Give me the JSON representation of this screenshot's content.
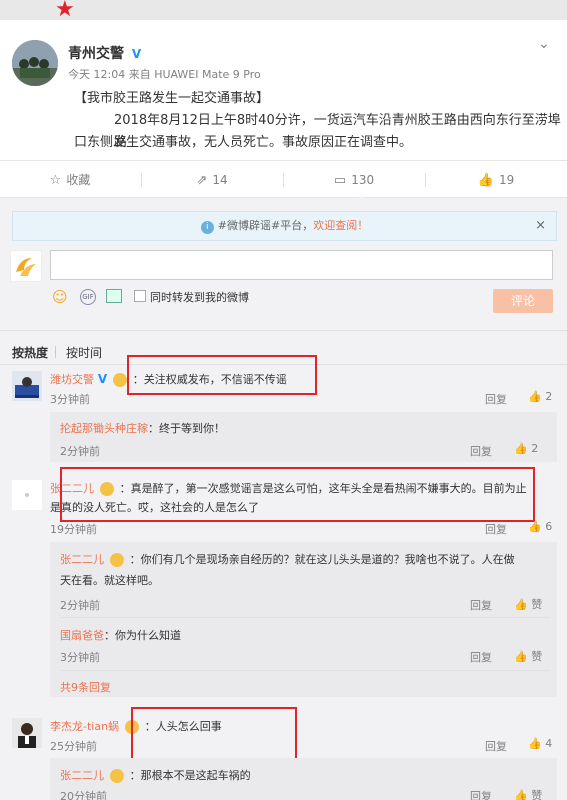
{
  "post": {
    "author": "青州交警",
    "meta": "今天 12:04 来自 HUAWEI Mate 9 Pro",
    "title": "【我市胶王路发生一起交通事故】",
    "body_line1": "2018年8月12日上午8时40分许，一货运汽车沿青州胶王路由西向东行至涝埠路",
    "body_line2": "口东侧发生交通事故，无人员死亡。事故原因正在调查中。"
  },
  "actions": {
    "favorite": "收藏",
    "forward": "14",
    "comment": "130",
    "like": "19"
  },
  "notice": {
    "prefix": "#微博辟谣#平台，",
    "highlight": "欢迎查阅！"
  },
  "composer": {
    "sync_label": "同时转发到我的微博",
    "submit": "评论"
  },
  "sort": {
    "hot": "按热度",
    "time": "按时间"
  },
  "comments": [
    {
      "name": "潍坊交警",
      "text": "：关注权威发布，不信谣不传谣",
      "time": "3分钟前",
      "reply": "回复",
      "likes": "2",
      "replies": [
        {
          "name": "抡起那锄头种庄稼",
          "text": "：终于等到你！",
          "time": "2分钟前",
          "reply": "回复",
          "likes": "2"
        }
      ]
    },
    {
      "name": "张二二儿",
      "text_line1": "：真是醉了，第一次感觉谣言是这么可怕，这年头全是看热闹不嫌事大的。目前为止",
      "text_line2": "是真的没人死亡。哎，这社会的人是怎么了",
      "time": "19分钟前",
      "reply": "回复",
      "likes": "6",
      "replies": [
        {
          "name": "张二二儿",
          "text_line1": "：你们有几个是现场亲自经历的？就在这儿头头是道的？我啥也不说了。人在做",
          "text_line2": "天在看。就这样吧。",
          "time": "2分钟前",
          "reply": "回复",
          "likes": "赞"
        },
        {
          "name": "国扇爸爸",
          "text": "：你为什么知道",
          "time": "3分钟前",
          "reply": "回复",
          "likes": "赞"
        }
      ],
      "more": "共9条回复"
    },
    {
      "name": "李杰龙-tian蜗",
      "text": "：人头怎么回事",
      "time": "25分钟前",
      "reply": "回复",
      "likes": "4",
      "replies": [
        {
          "name": "张二二儿",
          "text": "：那根本不是这起车祸的",
          "time": "20分钟前",
          "reply": "回复",
          "likes": "赞"
        }
      ]
    }
  ]
}
